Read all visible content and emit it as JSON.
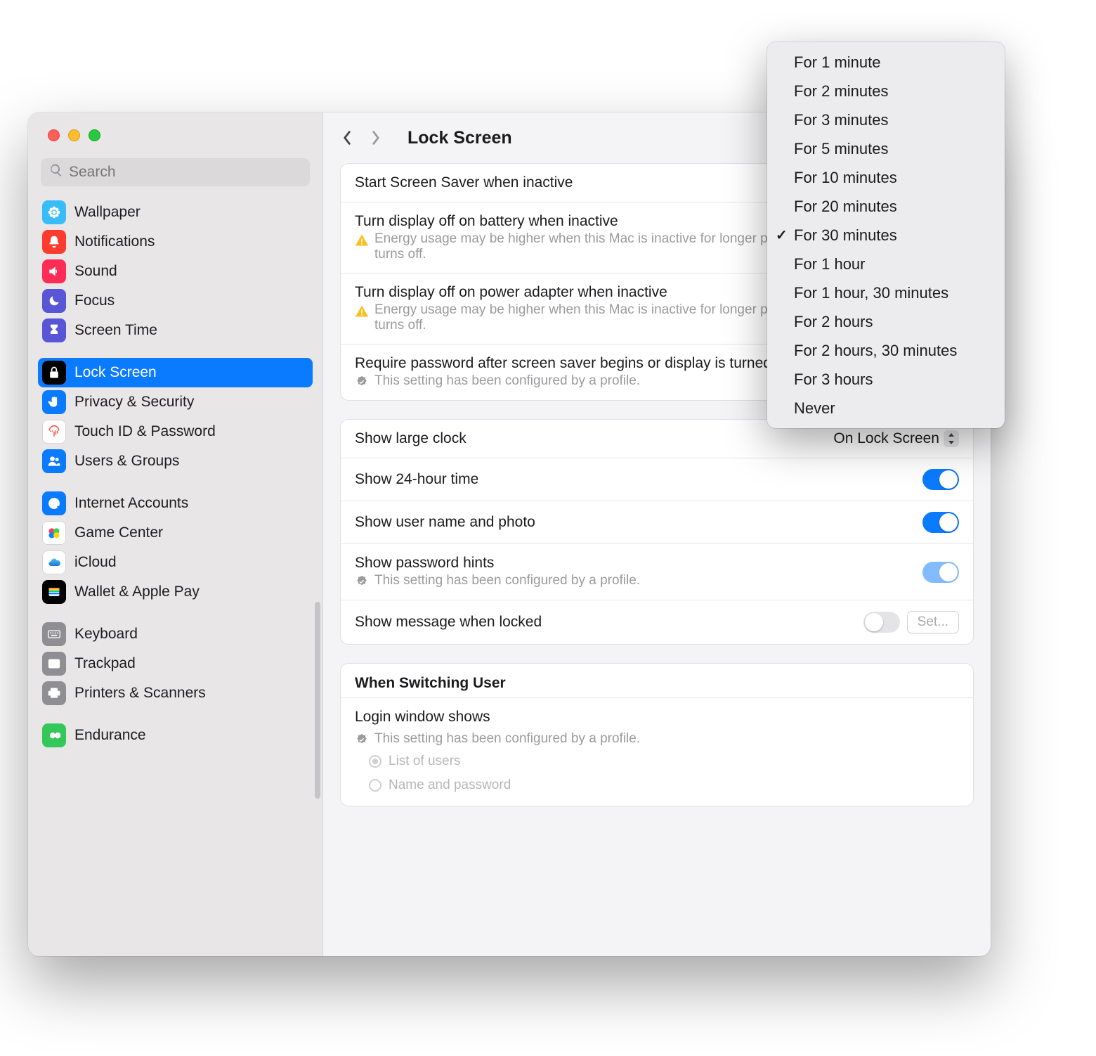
{
  "search": {
    "placeholder": "Search",
    "value": ""
  },
  "page_title": "Lock Screen",
  "sidebar": {
    "groups": [
      [
        {
          "label": "Wallpaper",
          "color": "#38bdf8",
          "icon": "flower"
        },
        {
          "label": "Notifications",
          "color": "#ff3b30",
          "icon": "bell"
        },
        {
          "label": "Sound",
          "color": "#ff2d55",
          "icon": "speaker"
        },
        {
          "label": "Focus",
          "color": "#5856d6",
          "icon": "moon"
        },
        {
          "label": "Screen Time",
          "color": "#5856d6",
          "icon": "hourglass"
        }
      ],
      [
        {
          "label": "Lock Screen",
          "color": "#000000",
          "icon": "lock",
          "selected": true
        },
        {
          "label": "Privacy & Security",
          "color": "#0a7aff",
          "icon": "hand"
        },
        {
          "label": "Touch ID & Password",
          "color": "#ffffff",
          "icon": "fingerprint",
          "fg": "#ff3b30",
          "border": true
        },
        {
          "label": "Users & Groups",
          "color": "#0a7aff",
          "icon": "users"
        }
      ],
      [
        {
          "label": "Internet Accounts",
          "color": "#0a7aff",
          "icon": "at"
        },
        {
          "label": "Game Center",
          "color": "#ffffff",
          "icon": "gamecenter",
          "border": true
        },
        {
          "label": "iCloud",
          "color": "#ffffff",
          "icon": "icloud",
          "border": true
        },
        {
          "label": "Wallet & Apple Pay",
          "color": "#000000",
          "icon": "wallet"
        }
      ],
      [
        {
          "label": "Keyboard",
          "color": "#8e8e93",
          "icon": "keyboard"
        },
        {
          "label": "Trackpad",
          "color": "#8e8e93",
          "icon": "trackpad"
        },
        {
          "label": "Printers & Scanners",
          "color": "#8e8e93",
          "icon": "printer"
        }
      ],
      [
        {
          "label": "Endurance",
          "color": "#34c759",
          "icon": "infinity"
        }
      ]
    ]
  },
  "panel1": {
    "r1": {
      "title": "Start Screen Saver when inactive"
    },
    "r2": {
      "title": "Turn display off on battery when inactive",
      "desc": "Energy usage may be higher when this Mac is inactive for longer periods of time before the display turns off."
    },
    "r3": {
      "title": "Turn display off on power adapter when inactive",
      "desc": "Energy usage may be higher when this Mac is inactive for longer periods of time before the display turns off."
    },
    "r4": {
      "title": "Require password after screen saver begins or display is turned off",
      "desc": "This setting has been configured by a profile."
    }
  },
  "panel2": {
    "large_clock": {
      "title": "Show large clock",
      "value": "On Lock Screen"
    },
    "time24": {
      "title": "Show 24-hour time",
      "on": true
    },
    "name_photo": {
      "title": "Show user name and photo",
      "on": true
    },
    "hints": {
      "title": "Show password hints",
      "desc": "This setting has been configured by a profile.",
      "on": true,
      "disabled": true
    },
    "message": {
      "title": "Show message when locked",
      "on": false,
      "btn": "Set..."
    }
  },
  "panel3": {
    "heading": "When Switching User",
    "login": {
      "title": "Login window shows",
      "desc": "This setting has been configured by a profile.",
      "opt1": "List of users",
      "opt2": "Name and password"
    }
  },
  "dropdown": {
    "items": [
      "For 1 minute",
      "For 2 minutes",
      "For 3 minutes",
      "For 5 minutes",
      "For 10 minutes",
      "For 20 minutes",
      "For 30 minutes",
      "For 1 hour",
      "For 1 hour, 30 minutes",
      "For 2 hours",
      "For 2 hours, 30 minutes",
      "For 3 hours",
      "Never"
    ],
    "selected": "For 30 minutes"
  }
}
